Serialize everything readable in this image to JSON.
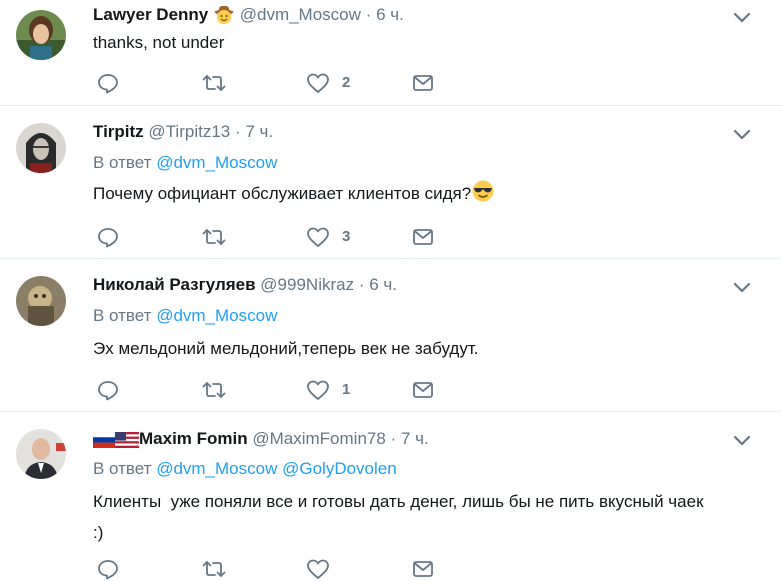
{
  "tweets": [
    {
      "name": "Lawyer Denny",
      "emoji": "cowboy-emoji",
      "handle": "@dvm_Moscow",
      "time": "6 ч.",
      "reply_prefix": "",
      "mentions": [],
      "text": "thanks, not under",
      "likes": "2"
    },
    {
      "name": "Tirpitz",
      "handle": "@Tirpitz13",
      "time": "7 ч.",
      "reply_prefix": "В ответ",
      "mentions": [
        "@dvm_Moscow"
      ],
      "text": "Почему официант обслуживает клиентов сидя?",
      "text_emoji": "sunglasses-emoji",
      "likes": "3"
    },
    {
      "name": "Николай Разгуляев",
      "handle": "@999Nikraz",
      "time": "6 ч.",
      "reply_prefix": "В ответ",
      "mentions": [
        "@dvm_Moscow"
      ],
      "text": "Эх мельдоний мельдоний,теперь век не забудут.",
      "likes": "1"
    },
    {
      "name": "Maxim Fomin",
      "flags": [
        "russia-flag",
        "usa-flag"
      ],
      "handle": "@MaximFomin78",
      "time": "7 ч.",
      "reply_prefix": "В ответ",
      "mentions": [
        "@dvm_Moscow",
        "@GolyDovolen"
      ],
      "text_line1": "Клиенты  уже поняли все и готовы дать денег, лишь бы не пить вкусный чаек",
      "text_line2": ":)",
      "likes": ""
    }
  ],
  "separator": "·",
  "colors": {
    "link": "#1da1f2",
    "muted": "#657786",
    "text": "#14171a",
    "divider": "#e6ecf0"
  }
}
